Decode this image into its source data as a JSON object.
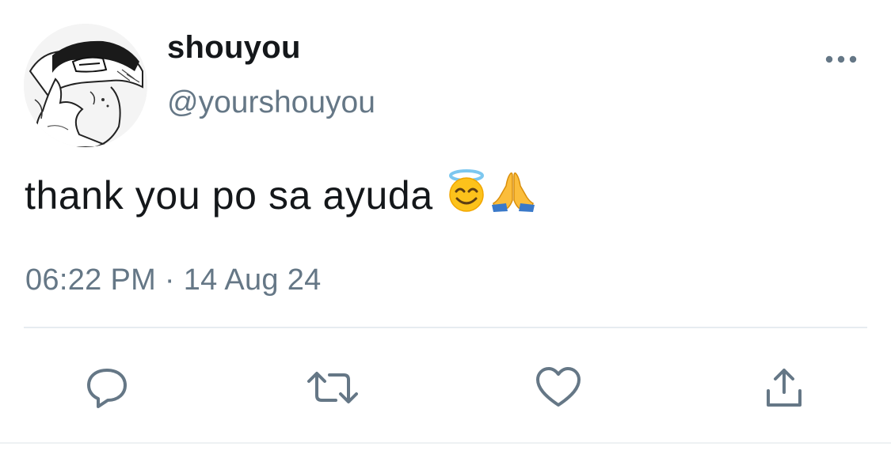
{
  "tweet": {
    "author": {
      "display_name": "shouyou",
      "handle": "@yourshouyou",
      "avatar_icon": "manga-character-avatar"
    },
    "text": "thank you po sa ayuda",
    "emojis": [
      "smiling-face-with-halo",
      "folded-hands"
    ],
    "timestamp": "06:22 PM · 14 Aug 24",
    "menu_icon": "more-horizontal-icon",
    "actions": [
      {
        "name": "reply",
        "icon": "reply-icon"
      },
      {
        "name": "retweet",
        "icon": "retweet-icon"
      },
      {
        "name": "like",
        "icon": "heart-icon"
      },
      {
        "name": "share",
        "icon": "share-icon"
      }
    ]
  },
  "colors": {
    "text_primary": "#14171a",
    "text_secondary": "#657786",
    "icon": "#657786",
    "divider": "#e6ecf0"
  }
}
